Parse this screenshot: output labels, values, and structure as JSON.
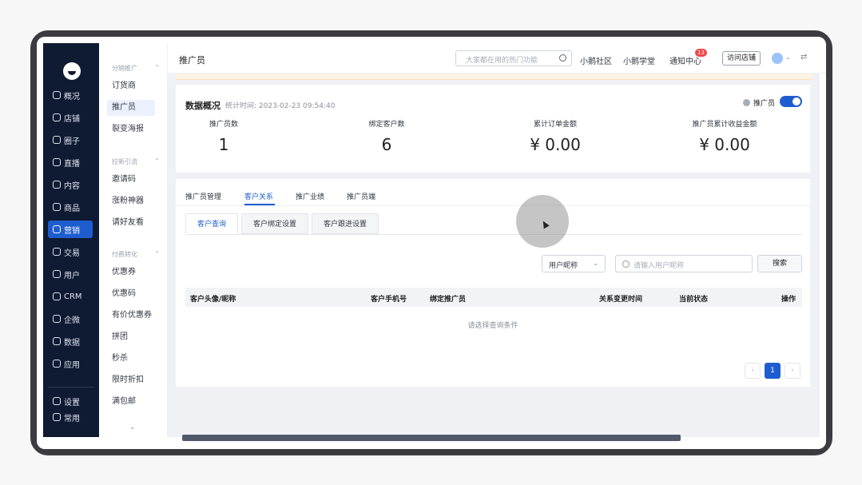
{
  "rail": {
    "items": [
      {
        "label": "概况"
      },
      {
        "label": "店铺"
      },
      {
        "label": "圈子"
      },
      {
        "label": "直播"
      },
      {
        "label": "内容"
      },
      {
        "label": "商品"
      },
      {
        "label": "营销"
      },
      {
        "label": "交易"
      },
      {
        "label": "用户"
      },
      {
        "label": "CRM"
      },
      {
        "label": "企微"
      },
      {
        "label": "数据"
      },
      {
        "label": "应用"
      },
      {
        "label": "设置"
      },
      {
        "label": "常用"
      }
    ],
    "active": "营销"
  },
  "submenu": {
    "groups": [
      {
        "title": "分销推广",
        "items": [
          "订货商",
          "推广员",
          "裂变海报"
        ]
      },
      {
        "title": "拉新引流",
        "items": [
          "邀请码",
          "涨粉神器",
          "请好友看"
        ]
      },
      {
        "title": "付费转化",
        "items": [
          "优惠券",
          "优惠码",
          "有价优惠券",
          "拼团",
          "秒杀",
          "限时折扣",
          "满包邮"
        ]
      }
    ],
    "active": "推广员"
  },
  "topbar": {
    "page_title": "推广员",
    "search_placeholder": "大家都在用的热门功能",
    "links": [
      "小鹅社区",
      "小鹅学堂",
      "通知中心"
    ],
    "notification_count": "13",
    "visit_store": "访问店铺"
  },
  "overview": {
    "title": "数据概况",
    "stat_time": "统计时间: 2023-02-23 09:54:40",
    "toggle_label": "推广员",
    "toggle_on": true,
    "stats": [
      {
        "label": "推广员数",
        "value": "1"
      },
      {
        "label": "绑定客户数",
        "value": "6"
      },
      {
        "label": "累计订单金额",
        "value": "¥ 0.00"
      },
      {
        "label": "推广员累计收益金额",
        "value": "¥ 0.00"
      }
    ]
  },
  "tabs": [
    "推广员管理",
    "客户关系",
    "推广业绩",
    "推广员端"
  ],
  "active_tab": "客户关系",
  "subtabs": [
    "客户查询",
    "客户绑定设置",
    "客户跟进设置"
  ],
  "active_subtab": "客户查询",
  "filter": {
    "select_value": "用户昵称",
    "input_placeholder": "请输入用户昵称",
    "search_button": "搜索"
  },
  "table": {
    "columns": [
      "客户头像/昵称",
      "客户手机号",
      "绑定推广员",
      "关系变更时间",
      "当前状态",
      "操作"
    ],
    "empty_text": "请选择查询条件"
  },
  "pagination": {
    "current": "1",
    "prev": "‹",
    "next": "›"
  }
}
